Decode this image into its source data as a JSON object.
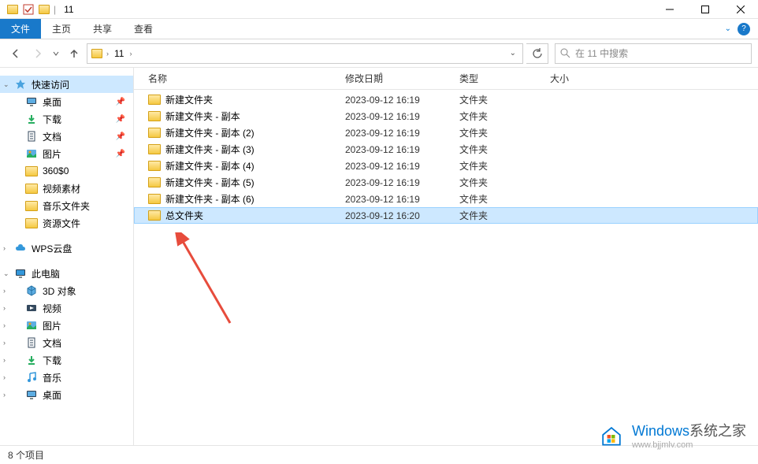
{
  "window": {
    "title": "11"
  },
  "ribbon": {
    "file": "文件",
    "tabs": [
      "主页",
      "共享",
      "查看"
    ]
  },
  "nav": {
    "path_segments": [
      "11"
    ],
    "search_placeholder": "在 11 中搜索"
  },
  "sidebar": {
    "quick_access": "快速访问",
    "quick_items": [
      {
        "label": "桌面",
        "icon": "desktop",
        "pinned": true
      },
      {
        "label": "下载",
        "icon": "download",
        "pinned": true
      },
      {
        "label": "文档",
        "icon": "document",
        "pinned": true
      },
      {
        "label": "图片",
        "icon": "picture",
        "pinned": true
      },
      {
        "label": "360$0",
        "icon": "folder",
        "pinned": false
      },
      {
        "label": "视频素材",
        "icon": "folder",
        "pinned": false
      },
      {
        "label": "音乐文件夹",
        "icon": "folder",
        "pinned": false
      },
      {
        "label": "资源文件",
        "icon": "folder",
        "pinned": false
      }
    ],
    "wps": "WPS云盘",
    "this_pc": "此电脑",
    "pc_items": [
      {
        "label": "3D 对象",
        "icon": "3d"
      },
      {
        "label": "视频",
        "icon": "video"
      },
      {
        "label": "图片",
        "icon": "picture"
      },
      {
        "label": "文档",
        "icon": "document"
      },
      {
        "label": "下载",
        "icon": "download"
      },
      {
        "label": "音乐",
        "icon": "music"
      },
      {
        "label": "桌面",
        "icon": "desktop"
      }
    ]
  },
  "columns": {
    "name": "名称",
    "date": "修改日期",
    "type": "类型",
    "size": "大小"
  },
  "files": [
    {
      "name": "新建文件夹",
      "date": "2023-09-12 16:19",
      "type": "文件夹",
      "selected": false
    },
    {
      "name": "新建文件夹 - 副本",
      "date": "2023-09-12 16:19",
      "type": "文件夹",
      "selected": false
    },
    {
      "name": "新建文件夹 - 副本 (2)",
      "date": "2023-09-12 16:19",
      "type": "文件夹",
      "selected": false
    },
    {
      "name": "新建文件夹 - 副本 (3)",
      "date": "2023-09-12 16:19",
      "type": "文件夹",
      "selected": false
    },
    {
      "name": "新建文件夹 - 副本 (4)",
      "date": "2023-09-12 16:19",
      "type": "文件夹",
      "selected": false
    },
    {
      "name": "新建文件夹 - 副本 (5)",
      "date": "2023-09-12 16:19",
      "type": "文件夹",
      "selected": false
    },
    {
      "name": "新建文件夹 - 副本 (6)",
      "date": "2023-09-12 16:19",
      "type": "文件夹",
      "selected": false
    },
    {
      "name": "总文件夹",
      "date": "2023-09-12 16:20",
      "type": "文件夹",
      "selected": true
    }
  ],
  "status": {
    "item_count": "8 个项目"
  },
  "watermark": {
    "brand_win": "Windows",
    "brand_rest": "系统之家",
    "url": "www.bjjmlv.com"
  }
}
